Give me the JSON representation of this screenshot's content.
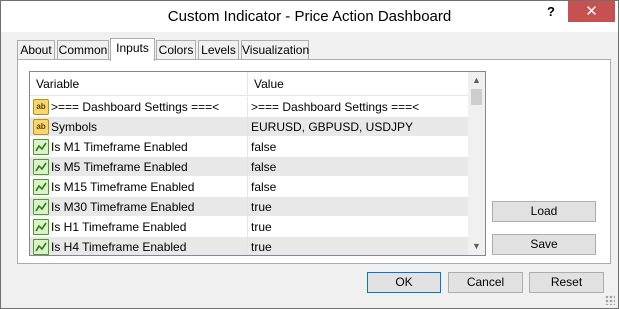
{
  "window": {
    "title": "Custom Indicator - Price Action Dashboard",
    "help_glyph": "?",
    "close_glyph": "✕"
  },
  "tabs": [
    {
      "label": "About"
    },
    {
      "label": "Common"
    },
    {
      "label": "Inputs",
      "active": true
    },
    {
      "label": "Colors"
    },
    {
      "label": "Levels"
    },
    {
      "label": "Visualization"
    }
  ],
  "grid": {
    "col_variable": "Variable",
    "col_value": "Value",
    "rows": [
      {
        "icon": "text-param-icon",
        "name": ">=== Dashboard Settings ===<",
        "value": ">=== Dashboard Settings ===<"
      },
      {
        "icon": "text-param-icon",
        "name": "Symbols",
        "value": "EURUSD, GBPUSD, USDJPY"
      },
      {
        "icon": "bool-param-icon",
        "name": "Is M1 Timeframe Enabled",
        "value": "false"
      },
      {
        "icon": "bool-param-icon",
        "name": "Is M5 Timeframe Enabled",
        "value": "false"
      },
      {
        "icon": "bool-param-icon",
        "name": "Is M15 Timeframe Enabled",
        "value": "false"
      },
      {
        "icon": "bool-param-icon",
        "name": "Is M30 Timeframe Enabled",
        "value": "true"
      },
      {
        "icon": "bool-param-icon",
        "name": "Is H1 Timeframe Enabled",
        "value": "true"
      },
      {
        "icon": "bool-param-icon",
        "name": "Is H4 Timeframe Enabled",
        "value": "true"
      }
    ],
    "text_icon_label": "ab"
  },
  "side_buttons": {
    "load": "Load",
    "save": "Save"
  },
  "footer_buttons": {
    "ok": "OK",
    "cancel": "Cancel",
    "reset": "Reset"
  },
  "colors": {
    "close_button": "#c75050",
    "default_button_border": "#0078d7",
    "alt_row": "#e8e8e8"
  }
}
